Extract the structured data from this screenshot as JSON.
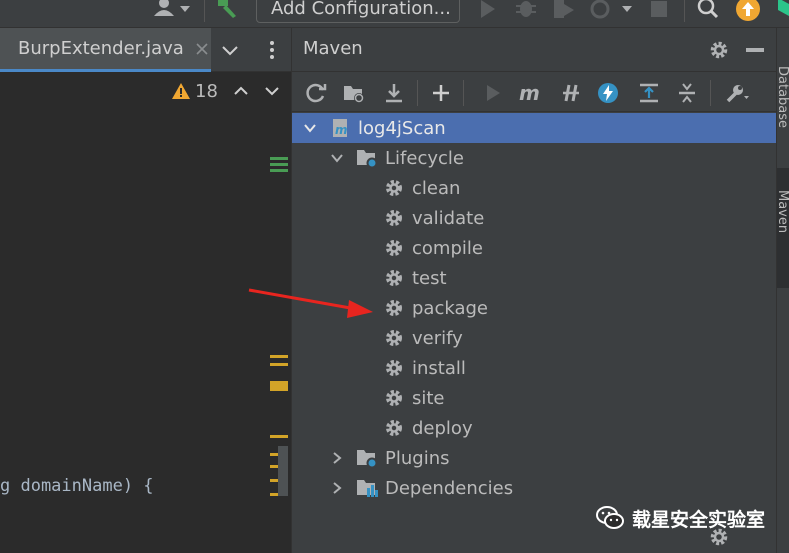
{
  "toolbar": {
    "run_configuration": "Add Configuration...",
    "icons": [
      "user-icon",
      "build-hammer-icon",
      "run-icon",
      "debug-icon",
      "run-with-coverage-icon",
      "profile-icon",
      "stop-icon",
      "search-icon",
      "update-icon"
    ]
  },
  "editor": {
    "active_tab": "BurpExtender.java",
    "inspection_count": "18",
    "code_visible": "g domainName) {"
  },
  "maven": {
    "title": "Maven",
    "toolbar_icons": [
      "reload-icon",
      "generate-sources-icon",
      "download-icon",
      "add-icon",
      "run-icon",
      "execute-goal-icon",
      "toggle-offline-icon",
      "skip-tests-icon",
      "show-dependencies-icon",
      "collapse-all-icon",
      "settings-wrench-icon"
    ],
    "project": "log4jScan",
    "lifecycle": {
      "label": "Lifecycle",
      "goals": [
        "clean",
        "validate",
        "compile",
        "test",
        "package",
        "verify",
        "install",
        "site",
        "deploy"
      ]
    },
    "plugins": "Plugins",
    "dependencies": "Dependencies"
  },
  "side_tabs": [
    "Database",
    "Maven"
  ],
  "watermark": "载星安全实验室",
  "colors": {
    "selection": "#4b6eaf",
    "panel_bg": "#3c3f41",
    "editor_bg": "#2b2b2b",
    "warning": "#f0a732",
    "annotation_arrow": "#e8251f"
  }
}
